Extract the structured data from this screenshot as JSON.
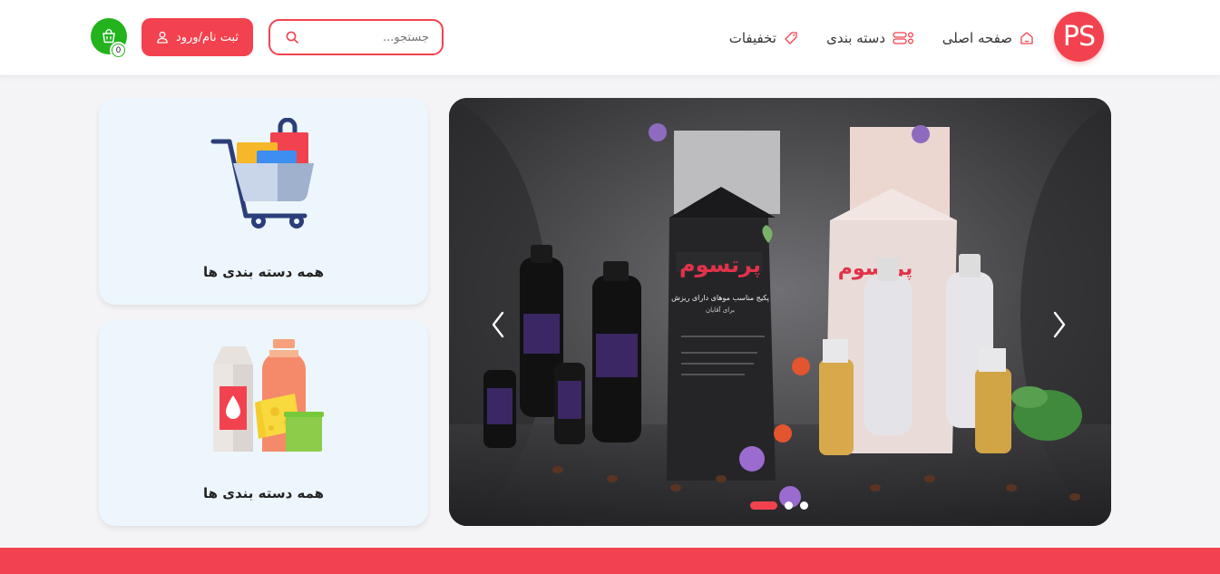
{
  "header": {
    "logo_text": "PS",
    "nav": {
      "home": "صفحه اصلی",
      "categories": "دسته بندی",
      "discounts": "تخفیفات"
    },
    "search_placeholder": "جستجو...",
    "login_label": "ثبت نام/ورود",
    "cart_count": "0"
  },
  "categories": [
    {
      "label": "همه دسته بندی ها",
      "icon": "shopping-cart-icon"
    },
    {
      "label": "همه دسته بندی ها",
      "icon": "groceries-icon"
    }
  ],
  "slider": {
    "image": "hair-care-products-banner",
    "brand_text": "پرتسوم",
    "box_headline": "پکیج مناسب موهای دارای ریزش",
    "box_sub": "برای آقایان",
    "slides_count": 3,
    "active_slide": 1
  },
  "colors": {
    "accent": "#f3424f",
    "cart_green": "#22b31d",
    "card_bg": "#ecf6fc",
    "page_bg": "#f4f4f6"
  }
}
